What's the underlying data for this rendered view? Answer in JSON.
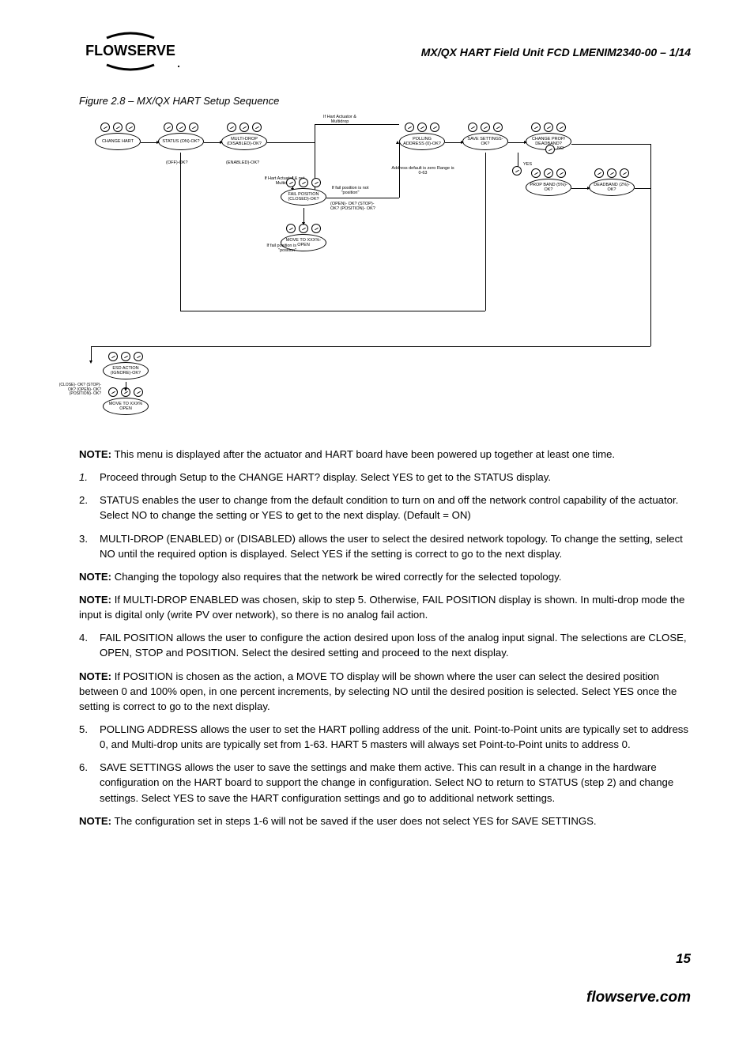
{
  "header": {
    "logo_text": "FLOWSERVE",
    "doc_title": "MX/QX HART Field Unit   FCD LMENIM2340-00 – 1/14"
  },
  "figure": {
    "caption": "Figure 2.8 – MX/QX HART Setup Sequence",
    "nodes": {
      "change_hart": "CHANGE HART",
      "status": "STATUS (ON)-OK?",
      "multidrop": "MULTI-DROP (DISABLED)-OK?",
      "fail_pos": "FAIL POSITION (CLOSED)-OK?",
      "move_to_1": "MOVE TO XXX%-OPEN",
      "polling": "POLLING ADDRESS (0)-OK?",
      "save": "SAVE SETTINGS-OK?",
      "change_prop": "CHANGE PROP/ DEADBAND?",
      "prop_band": "PROP BAND (5%)-OK?",
      "deadband": "DEADBAND (2%)-OK?",
      "esd_action": "ESD ACTION (IGNORE)-OK?",
      "move_to_2": "MOVE TO XXX% OPEN"
    },
    "labels": {
      "off_ok": "(OFF)-OK?",
      "enabled_ok": "(ENABLED)-OK?",
      "if_hart_multi": "If Hart Actuator & Multidrop",
      "if_hart_not_multi": "If Hart Actuator & not Multidrop",
      "if_fail_not_pos": "If fail position is not \"position\"",
      "if_fail_pos": "If fail position is \"position\"",
      "open_stop_pos": "(OPEN)- OK? (STOP)- OK? (POSITION)- OK?",
      "addr_default": "Address default is zero Range is 0-63",
      "no": "NO",
      "yes": "YES",
      "close_stop_open_pos": "(CLOSE)- OK? (STOP)- OK? (OPEN)- OK? (POSITION)- OK?"
    }
  },
  "body": {
    "note1_label": "NOTE:",
    "note1": " This menu is displayed after the actuator and HART board have been powered up together at least one time.",
    "li1": "Proceed through Setup to the CHANGE HART? display. Select YES to get to the STATUS display.",
    "li2": "STATUS enables the user to change from the default condition to turn on and off the network control capability of the actuator. Select NO to change the setting or YES to get to the next display. (Default = ON)",
    "li3": "MULTI-DROP (ENABLED) or (DISABLED) allows the user to select the desired network topology. To change the setting, select NO until the required option is displayed. Select YES if the setting is correct to go to the next display.",
    "note2_label": "NOTE:",
    "note2": " Changing the topology also requires that the network be wired correctly for the selected topology.",
    "note3_label": "NOTE:",
    "note3": " If MULTI-DROP ENABLED was chosen, skip to step 5. Otherwise, FAIL POSITION display is shown. In multi-drop mode the input is digital only (write PV over network), so there is no analog fail action.",
    "li4": "FAIL POSITION allows the user to configure the action desired upon loss of the analog input signal. The selections are CLOSE, OPEN, STOP and POSITION. Select the desired setting and proceed to the next display.",
    "note4_label": "NOTE:",
    "note4": " If POSITION is chosen as the action, a MOVE TO display will be shown where the user can select the desired position between 0 and 100% open, in one percent increments, by selecting NO until the desired position is selected. Select YES once the setting is correct to go to the next display.",
    "li5": "POLLING ADDRESS allows the user to set the HART polling address of the unit. Point-to-Point units are typically set to address 0, and Multi-drop units are typically set from 1-63. HART 5 masters will always set Point-to-Point units to address 0.",
    "li6": "SAVE SETTINGS allows the user to save the settings and make them active. This can result in a change in the hardware configuration on the HART board to support the change in configuration. Select NO to return to STATUS (step 2) and change settings. Select YES to save the HART configuration settings and go to additional network settings.",
    "note5_label": "NOTE:",
    "note5": " The configuration set in steps 1-6 will not be saved if the user does not select YES for SAVE SETTINGS."
  },
  "footer": {
    "page_num": "15",
    "url": "flowserve.com"
  }
}
